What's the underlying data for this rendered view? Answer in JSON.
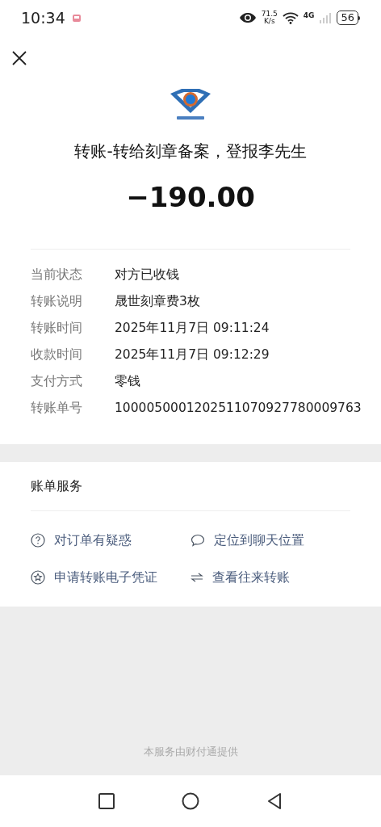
{
  "status_bar": {
    "time": "10:34",
    "speed": "71.5",
    "speed_unit": "K/s",
    "network": "4G",
    "battery": "56"
  },
  "title": "转账-转给刻章备案，登报李先生",
  "amount": "−190.00",
  "details": [
    {
      "label": "当前状态",
      "value": "对方已收钱"
    },
    {
      "label": "转账说明",
      "value": "晟世刻章费3枚"
    },
    {
      "label": "转账时间",
      "value": "2025年11月7日 09:11:24"
    },
    {
      "label": "收款时间",
      "value": "2025年11月7日 09:12:29"
    },
    {
      "label": "支付方式",
      "value": "零钱"
    },
    {
      "label": "转账单号",
      "value": "1000050001202511070927780009763"
    }
  ],
  "services": {
    "title": "账单服务",
    "items": [
      {
        "kind": "question",
        "label": "对订单有疑惑"
      },
      {
        "kind": "chat",
        "label": "定位到聊天位置"
      },
      {
        "kind": "star",
        "label": "申请转账电子凭证"
      },
      {
        "kind": "swap",
        "label": "查看往来转账"
      }
    ]
  },
  "footer": "本服务由财付通提供"
}
